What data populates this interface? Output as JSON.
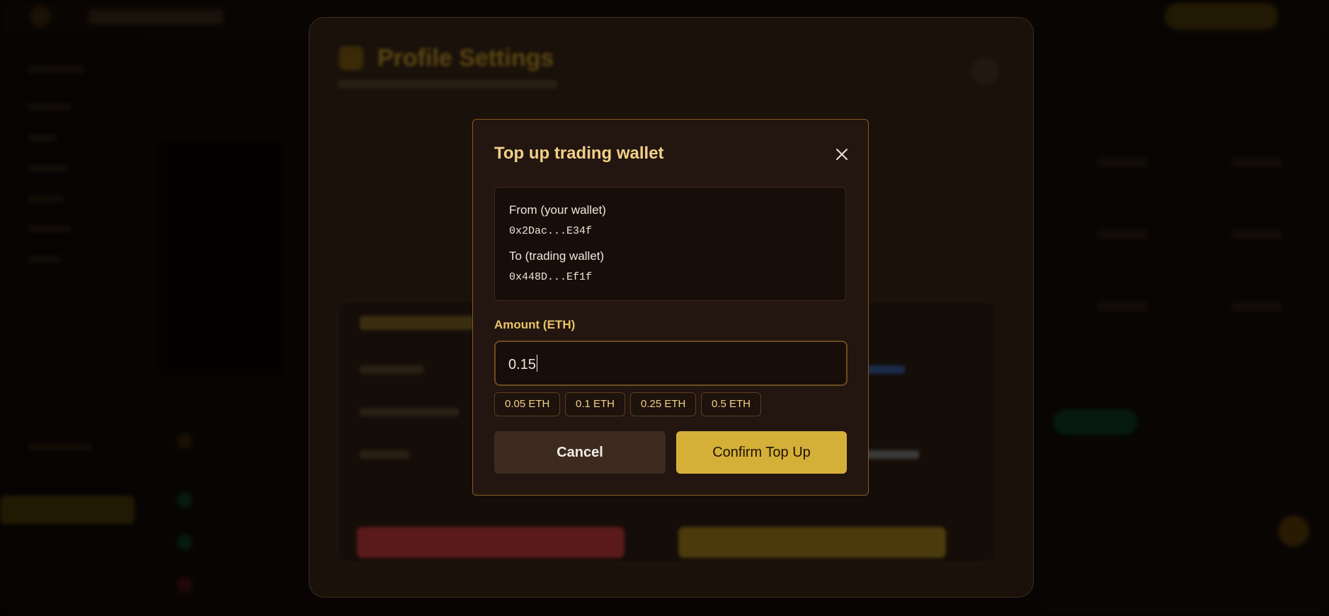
{
  "modal": {
    "title": "Top up trading wallet",
    "from_label": "From (your wallet)",
    "from_address": "0x2Dac...E34f",
    "to_label": "To (trading wallet)",
    "to_address": "0x448D...Ef1f",
    "amount_label": "Amount (ETH)",
    "amount_value": "0.15",
    "presets": [
      "0.05 ETH",
      "0.1 ETH",
      "0.25 ETH",
      "0.5 ETH"
    ],
    "cancel_label": "Cancel",
    "confirm_label": "Confirm Top Up"
  },
  "background": {
    "profile_title": "Profile Settings"
  },
  "colors": {
    "modal_bg": "#231510",
    "modal_border": "#8a5a22",
    "title": "#f1d188",
    "accent": "#d4b038",
    "cancel_bg": "#3d2b20"
  },
  "icons": {
    "close": "close-icon"
  }
}
